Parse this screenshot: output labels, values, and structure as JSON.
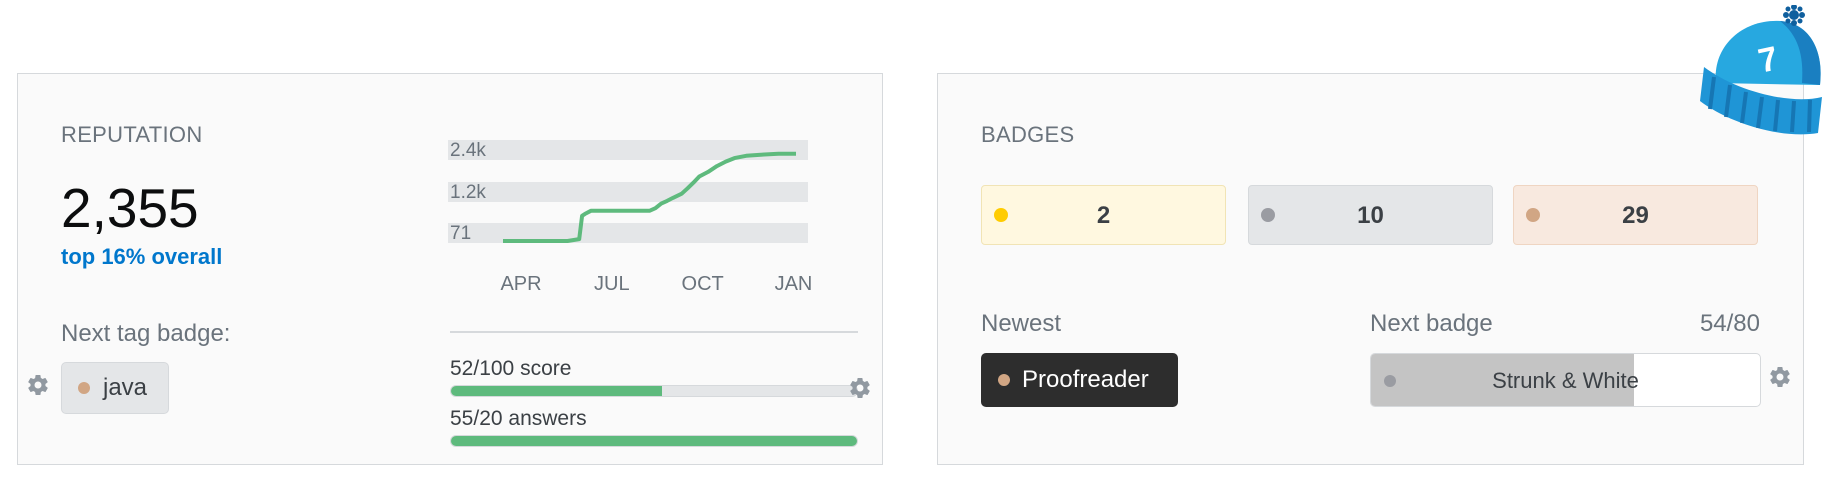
{
  "reputation": {
    "title": "REPUTATION",
    "value": "2,355",
    "rank": "top 16% overall",
    "next_tag_label": "Next tag badge:",
    "next_tag": {
      "name": "java",
      "color": "#d1a684"
    },
    "progress": [
      {
        "label": "52/100 score",
        "fraction": 0.52
      },
      {
        "label": "55/20 answers",
        "fraction": 1.0
      }
    ]
  },
  "chart_data": {
    "type": "line",
    "title": "",
    "xlabel": "",
    "ylabel": "",
    "x_ticks": [
      "APR",
      "JUL",
      "OCT",
      "JAN"
    ],
    "y_ticks": [
      "2.4k",
      "1.2k",
      "71"
    ],
    "y_tick_values": [
      2400,
      1200,
      71
    ],
    "ylim": [
      71,
      2400
    ],
    "line_color": "#5eba7d",
    "series": [
      {
        "values": [
          {
            "x": 0,
            "y": 71
          },
          {
            "x": 22,
            "y": 71
          },
          {
            "x": 26,
            "y": 120
          },
          {
            "x": 27,
            "y": 730
          },
          {
            "x": 28,
            "y": 780
          },
          {
            "x": 30,
            "y": 860
          },
          {
            "x": 50,
            "y": 860
          },
          {
            "x": 52,
            "y": 930
          },
          {
            "x": 54,
            "y": 1050
          },
          {
            "x": 56,
            "y": 1120
          },
          {
            "x": 58,
            "y": 1200
          },
          {
            "x": 61,
            "y": 1310
          },
          {
            "x": 63,
            "y": 1450
          },
          {
            "x": 65,
            "y": 1600
          },
          {
            "x": 67,
            "y": 1760
          },
          {
            "x": 70,
            "y": 1880
          },
          {
            "x": 73,
            "y": 2030
          },
          {
            "x": 76,
            "y": 2150
          },
          {
            "x": 79,
            "y": 2240
          },
          {
            "x": 83,
            "y": 2300
          },
          {
            "x": 88,
            "y": 2330
          },
          {
            "x": 94,
            "y": 2355
          },
          {
            "x": 100,
            "y": 2355
          }
        ]
      }
    ]
  },
  "badges": {
    "title": "BADGES",
    "gold": {
      "count": "2",
      "color": "#ffcc01"
    },
    "silver": {
      "count": "10",
      "color": "#9a9ca2"
    },
    "bronze": {
      "count": "29",
      "color": "#d1a684"
    },
    "newest_label": "Newest",
    "newest": {
      "name": "Proofreader",
      "color": "#d1a684"
    },
    "next_label": "Next badge",
    "next_progress_text": "54/80",
    "next_progress_fraction": 0.675,
    "next": {
      "name": "Strunk & White",
      "color": "#9a9ca2"
    }
  },
  "icons": {
    "settings": "gear-icon",
    "hat": "winter-hat-icon",
    "hat_number": "7",
    "hat_color": "#27a8e0"
  }
}
